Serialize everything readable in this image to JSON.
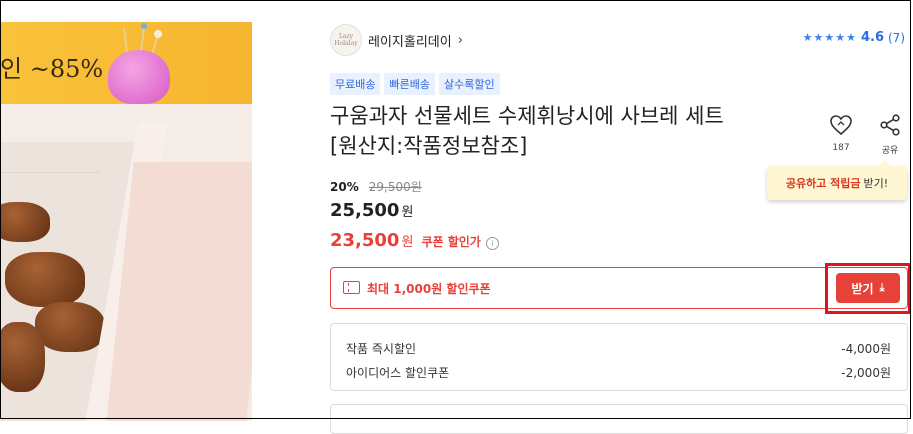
{
  "image": {
    "promo_text": "인 ~85%"
  },
  "brand": {
    "logo_text": "Lazy Holiday",
    "name": "레이지홀리데이",
    "chevron": "›"
  },
  "rating": {
    "stars": "★★★★★",
    "score": "4.6",
    "count": "(7)",
    "accent_color": "#2b6de4"
  },
  "tags": [
    "무료배송",
    "빠른배송",
    "살수록할인"
  ],
  "title": "구움과자 선물세트 수제휘낭시에 사브레 세트 [원산지:작품정보참조]",
  "actions": {
    "like_count": "187",
    "share_label": "공유"
  },
  "tooltip": {
    "highlight": "공유하고 적립금",
    "rest": "받기!"
  },
  "price": {
    "discount_pct": "20%",
    "original": "29,500원",
    "current": "25,500",
    "currency": "원",
    "coupon_price": "23,500",
    "coupon_label": "쿠폰 할인가",
    "info_icon": "i",
    "accent_color": "#e8413a"
  },
  "coupon": {
    "text": "최대 1,000원 할인쿠폰",
    "button_label": "받기",
    "button_icon": "⤓"
  },
  "breakdown": [
    {
      "label": "작품 즉시할인",
      "value": "-4,000원"
    },
    {
      "label": "아이디어스 할인쿠폰",
      "value": "-2,000원"
    }
  ]
}
